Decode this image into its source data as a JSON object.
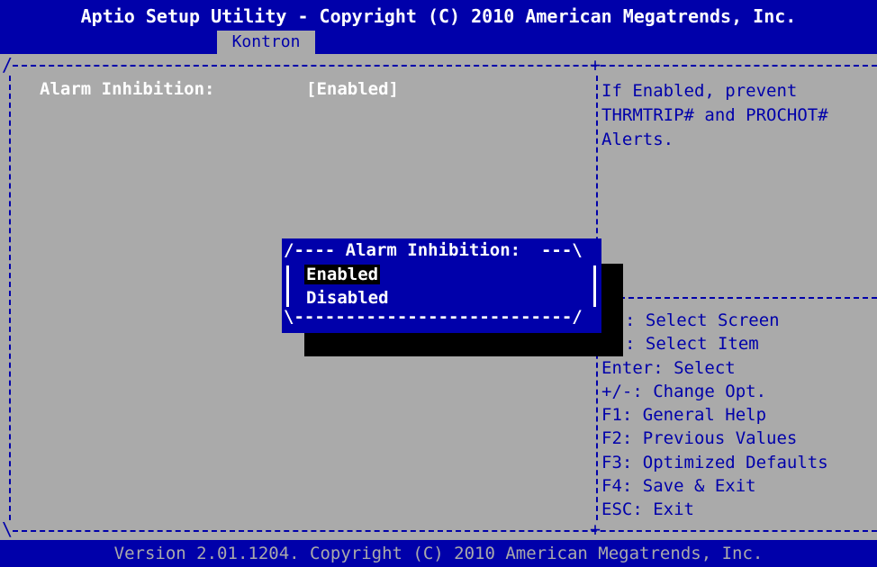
{
  "header": {
    "title": "Aptio Setup Utility - Copyright (C) 2010 American Megatrends, Inc.",
    "tab": "Kontron"
  },
  "setting": {
    "label": "Alarm Inhibition:",
    "value": "[Enabled]"
  },
  "help": {
    "lines": [
      "If Enabled, prevent",
      "THRMTRIP# and PROCHOT#",
      "Alerts."
    ]
  },
  "keys": [
    ": Select Screen",
    ": Select Item",
    "Enter: Select",
    "+/-: Change Opt.",
    "F1: General Help",
    "F2: Previous Values",
    "F3: Optimized Defaults",
    "F4: Save & Exit",
    "ESC: Exit"
  ],
  "popup": {
    "top": "/---- Alarm Inhibition:  ---\\",
    "bottom": "\\---------------------------/",
    "options": [
      "Enabled",
      "Disabled"
    ],
    "selected": "Enabled"
  },
  "footer": "Version 2.01.1204. Copyright (C) 2010 American Megatrends, Inc.",
  "colors": {
    "background": "#aaaaaa",
    "accent": "#0000aa",
    "text_highlight": "#ffffff",
    "shadow": "#000000"
  }
}
